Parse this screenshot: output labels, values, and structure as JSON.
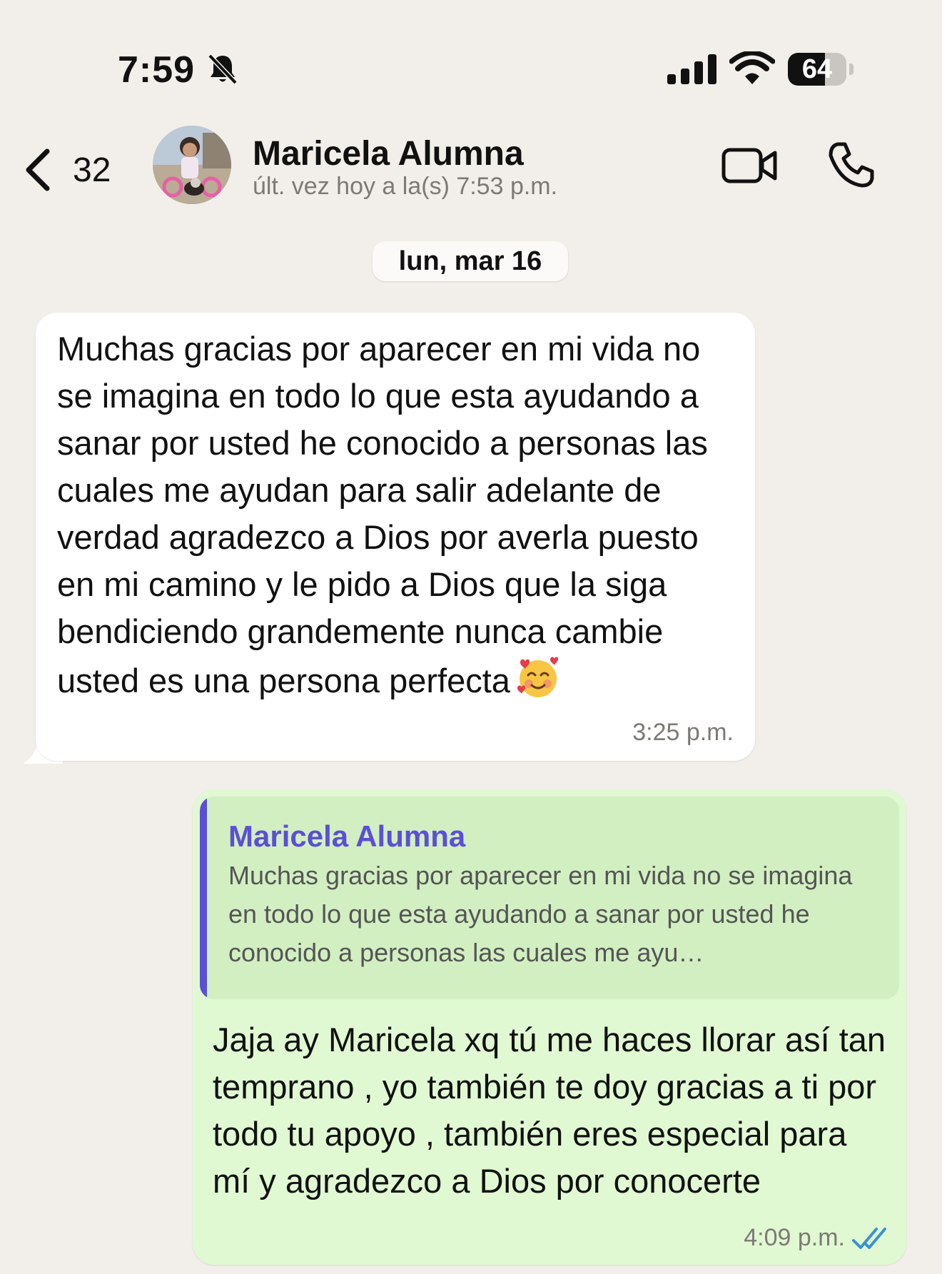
{
  "status_bar": {
    "time": "7:59",
    "battery_level": "64",
    "battery_fraction": 0.64,
    "icons": [
      "bell-slash-icon",
      "cellular-signal-icon",
      "wifi-icon",
      "battery-icon"
    ]
  },
  "header": {
    "back_count": "32",
    "contact_name": "Maricela Alumna",
    "last_seen": "últ. vez hoy a la(s) 7:53 p.m.",
    "icons": [
      "chevron-left-icon",
      "video-camera-icon",
      "phone-icon"
    ]
  },
  "date_separator": "lun, mar 16",
  "messages": [
    {
      "direction": "incoming",
      "text": "Muchas gracias por aparecer en mi vida no se imagina en todo lo que esta ayudando a sanar por usted he conocido a personas las cuales me ayudan para salir adelante de verdad agradezco a Dios por averla puesto en mi camino y le pido a Dios que la siga bendiciendo grandemente nunca cambie usted es una persona perfecta",
      "emoji": "smiling-face-with-hearts",
      "time": "3:25 p.m."
    },
    {
      "direction": "outgoing",
      "quoted_name": "Maricela Alumna",
      "quoted_text": "Muchas gracias por aparecer en mi vida no se imagina en todo lo que esta ayudando a sanar por usted he conocido a personas las cuales me ayu…",
      "text": "Jaja ay Maricela xq tú me haces llorar así tan temprano , yo también te doy gracias a ti por todo tu apoyo , también eres especial para mí y agradezco a Dios por conocerte",
      "time": "4:09 p.m.",
      "read_status": "read"
    }
  ],
  "colors": {
    "background": "#f2efea",
    "incoming_bubble": "#ffffff",
    "outgoing_bubble": "#e0f9d2",
    "quote_accent": "#5b4fd6",
    "read_check": "#3a8fd9"
  }
}
